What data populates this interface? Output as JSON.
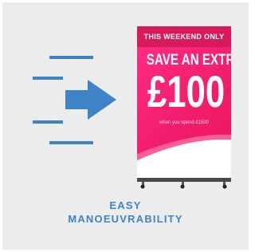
{
  "poster": {
    "heading": "THIS WEEKEND ONLY",
    "line1": "SAVE AN EXTRA",
    "amount": "£100",
    "subtext": "when you spend £1500"
  },
  "caption": {
    "line1": "EASY",
    "line2": "MANOEUVRABILITY"
  },
  "colors": {
    "background": "#ececec",
    "accent_blue": "#3d84c6",
    "poster_pink": "#f21d6d"
  },
  "icons": [
    "speed-lines-icon",
    "arrow-right-icon"
  ]
}
